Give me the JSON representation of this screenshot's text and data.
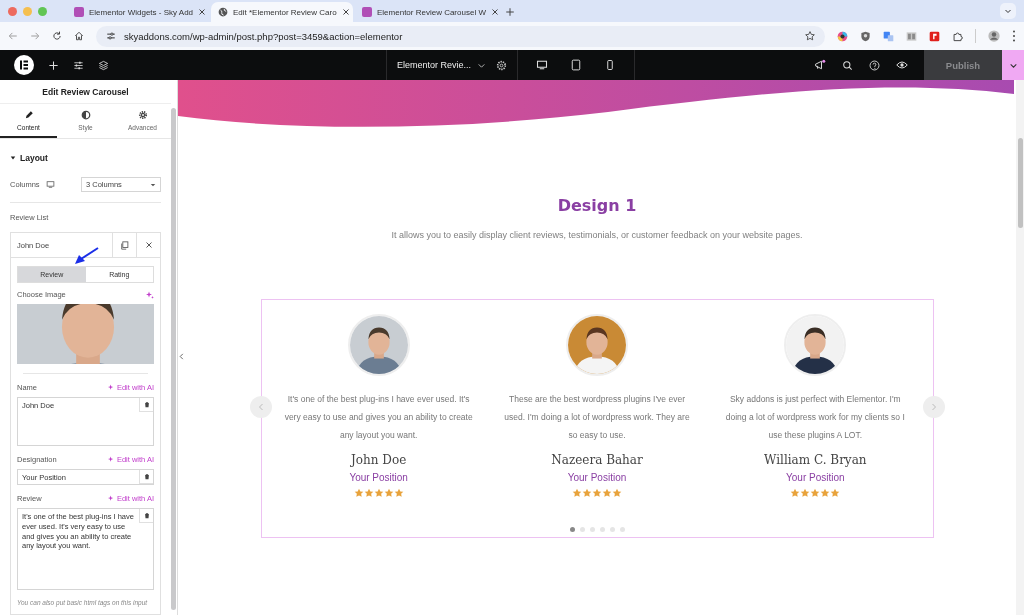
{
  "browser": {
    "tabs": [
      {
        "title": "Elementor Widgets - Sky Add",
        "selected": false,
        "kind": "plugin"
      },
      {
        "title": "Edit *Elementor Review Caro",
        "selected": true,
        "kind": "globe"
      },
      {
        "title": "Elementor Review Carousel W",
        "selected": false,
        "kind": "plugin"
      }
    ],
    "url": "skyaddons.com/wp-admin/post.php?post=3459&action=elementor"
  },
  "editor_bar": {
    "page_title": "Elementor Revie...",
    "publish": "Publish"
  },
  "panel": {
    "title": "Edit Review Carousel",
    "tabs": [
      {
        "label": "Content",
        "kind": "pencil",
        "selected": true
      },
      {
        "label": "Style",
        "kind": "contrast",
        "selected": false
      },
      {
        "label": "Advanced",
        "kind": "gear",
        "selected": false
      }
    ],
    "section": {
      "title": "Layout",
      "expanded": true
    },
    "columns": {
      "label": "Columns",
      "value": "3 Columns"
    },
    "review_list": {
      "label": "Review List",
      "item": {
        "title": "John Doe",
        "subtabs": [
          {
            "label": "Review",
            "selected": true
          },
          {
            "label": "Rating",
            "selected": false
          }
        ],
        "image_label": "Choose Image",
        "fields": [
          {
            "label": "Name",
            "ai_link": "Edit with AI",
            "value": "John Doe",
            "kind": "textarea"
          },
          {
            "label": "Designation",
            "ai_link": "Edit with AI",
            "value": "Your Position",
            "kind": "input"
          },
          {
            "label": "Review",
            "ai_link": "Edit with AI",
            "value": "It's one of the best plug-ins I have ever used. It's very easy to use and gives you an ability to create any layout you want.",
            "kind": "textarea"
          }
        ],
        "hint": "You can also put basic html tags on this input"
      }
    }
  },
  "canvas": {
    "heading": "Design 1",
    "subtitle": "It allows you to easily display client reviews, testimonials, or customer feedback on your website pages.",
    "reviews": [
      {
        "text": "It's one of the best plug-ins I have ever used. It's very easy to use and gives you an ability to create any layout you want.",
        "name": "John Doe",
        "position": "Your Position",
        "stars": 5
      },
      {
        "text": "These are the best wordpress plugins I've ever used. I'm doing a lot of wordpress work. They are so easy to use.",
        "name": "Nazeera Bahar",
        "position": "Your Position",
        "stars": 5
      },
      {
        "text": "Sky addons is just perfect with Elementor. I'm doing a lot of wordpress work for my clients so I use these plugins A LOT.",
        "name": "William C. Bryan",
        "position": "Your Position",
        "stars": 5
      }
    ],
    "dots": [
      {
        "selected": true
      },
      {
        "selected": false
      },
      {
        "selected": false
      },
      {
        "selected": false
      },
      {
        "selected": false
      },
      {
        "selected": false
      }
    ]
  }
}
